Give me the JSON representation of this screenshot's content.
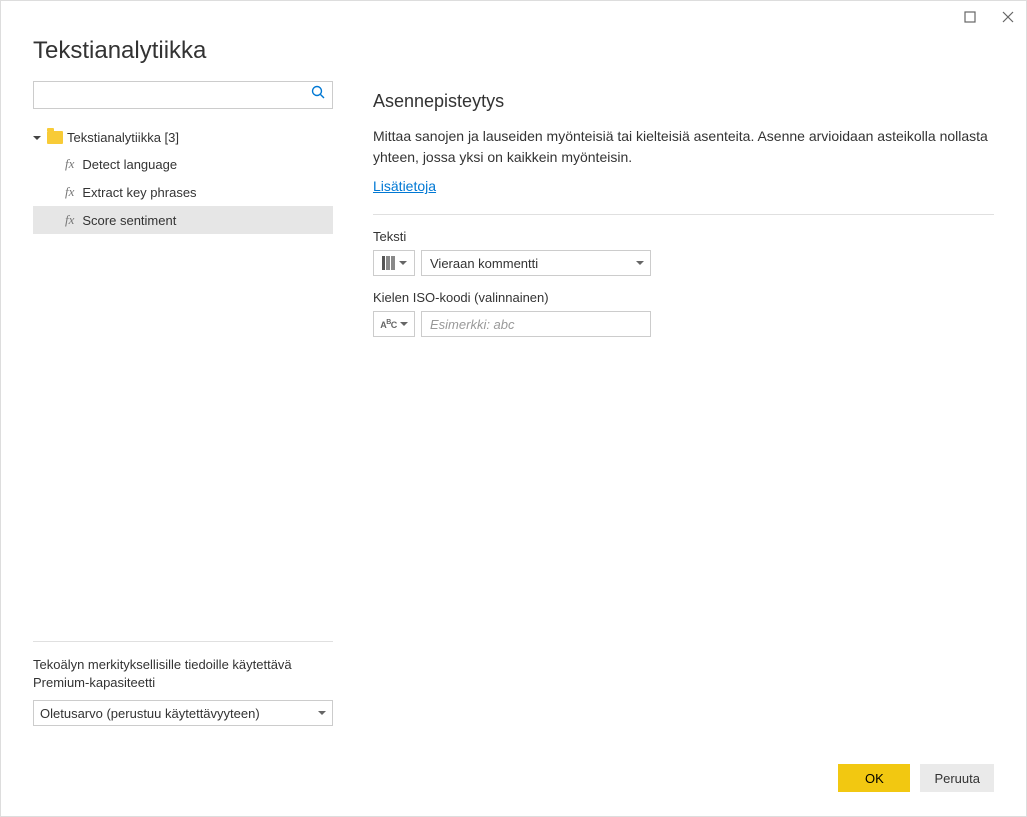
{
  "dialog": {
    "title": "Tekstianalytiikka"
  },
  "sidebar": {
    "groupLabel": "Tekstianalytiikka [3]",
    "items": [
      {
        "label": "Detect language"
      },
      {
        "label": "Extract key phrases"
      },
      {
        "label": "Score sentiment"
      }
    ],
    "footerLabel": "Tekoälyn merkityksellisille tiedoille käytettävä Premium-kapasiteetti",
    "footerSelectValue": "Oletusarvo (perustuu käytettävyyteen)"
  },
  "main": {
    "sectionTitle": "Asennepisteytys",
    "description": "Mittaa sanojen ja lauseiden myönteisiä tai kielteisiä asenteita. Asenne arvioidaan asteikolla nollasta yhteen, jossa yksi on kaikkein myönteisin.",
    "link": "Lisätietoja",
    "fields": [
      {
        "label": "Teksti",
        "value": "Vieraan kommentti",
        "type": "select"
      },
      {
        "label": "Kielen ISO-koodi (valinnainen)",
        "placeholder": "Esimerkki: abc",
        "type": "input"
      }
    ]
  },
  "buttons": {
    "ok": "OK",
    "cancel": "Peruuta"
  }
}
